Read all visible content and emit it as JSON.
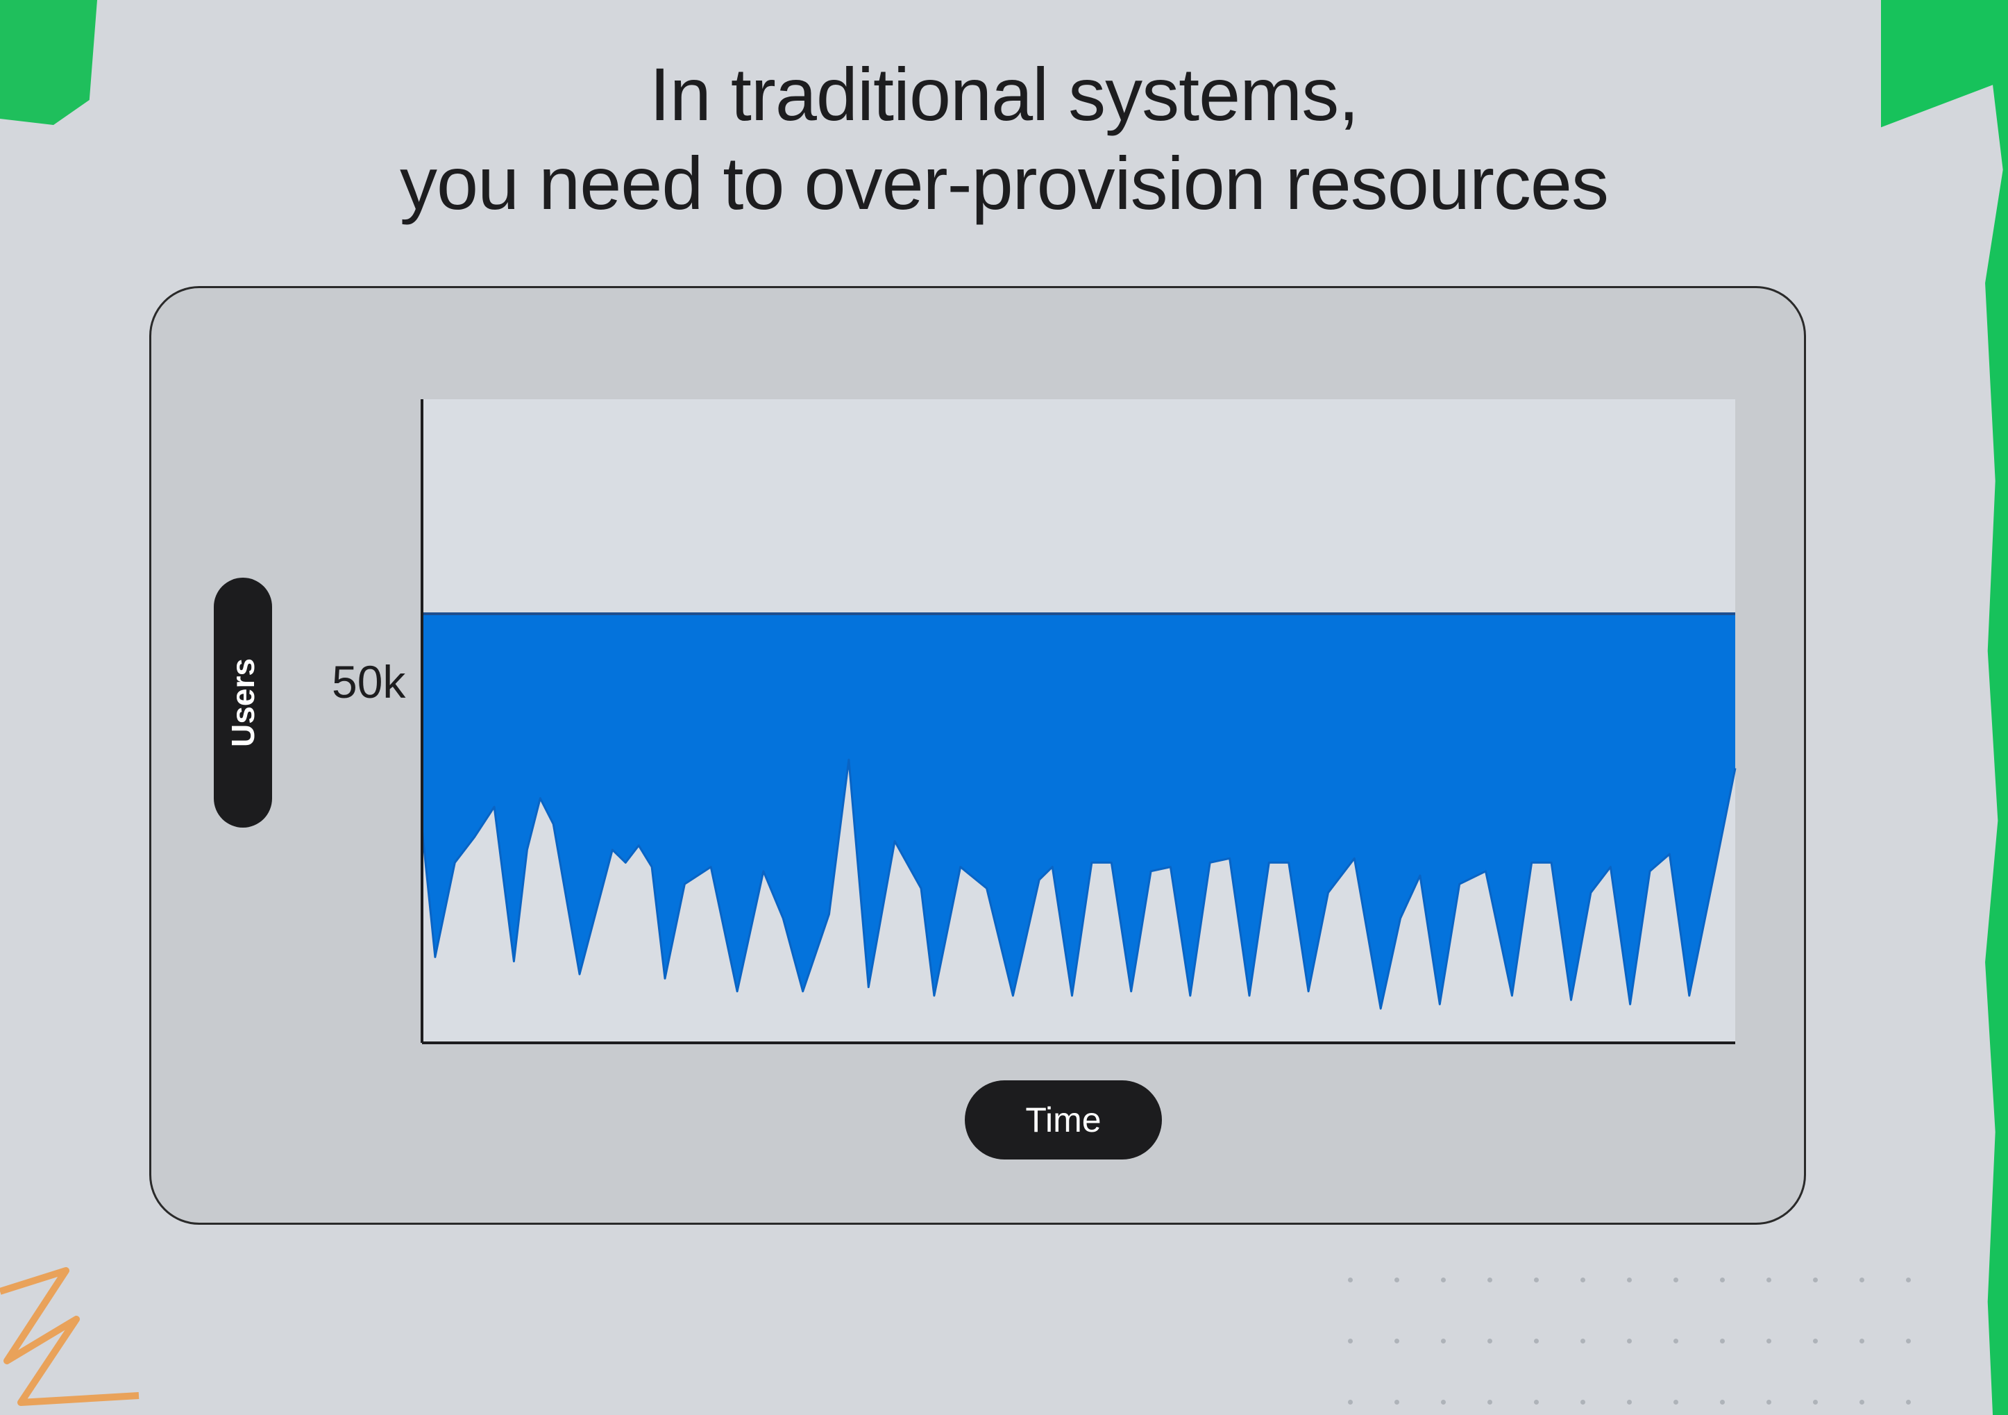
{
  "slide": {
    "title_line1": "In traditional systems,",
    "title_line2": "you need to over-provision resources"
  },
  "colors": {
    "background": "#d4d7dc",
    "accent_green": "#17c25b",
    "provisioned_fill": "#0473dc",
    "plot_background": "#d9dde3",
    "pill": "#1c1c1e"
  },
  "chart_data": {
    "type": "area",
    "title": "",
    "xlabel": "Time",
    "ylabel": "Users",
    "y_tick_labels": [
      {
        "value": 50000,
        "label": "50k"
      }
    ],
    "ylim": [
      0,
      75000
    ],
    "grid": false,
    "series": [
      {
        "name": "",
        "role": "provisioned capacity (flat)",
        "color": "#0473dc",
        "x": [
          0,
          100
        ],
        "values": [
          50000,
          50000
        ]
      },
      {
        "name": "",
        "role": "actual demand (curve under blue fill)",
        "x": [
          0,
          1,
          2.5,
          4,
          5.5,
          7,
          8,
          9,
          10,
          12,
          14.5,
          15.5,
          16.5,
          17.5,
          18.5,
          20,
          22,
          24,
          26,
          27.5,
          29,
          31,
          32.5,
          34,
          36,
          38,
          39,
          41,
          43,
          45,
          47,
          48,
          49.5,
          51,
          52.5,
          54,
          55.5,
          57,
          58.5,
          60,
          61.5,
          63,
          64.5,
          66,
          67.5,
          69,
          71,
          73,
          74.5,
          76,
          77.5,
          79,
          81,
          83,
          84.5,
          86,
          87.5,
          89,
          90.5,
          92,
          93.5,
          95,
          96.5,
          98.5,
          100
        ],
        "values": [
          25000,
          10000,
          21000,
          24000,
          27500,
          9500,
          22500,
          28500,
          25500,
          8000,
          22500,
          21000,
          23000,
          20500,
          7500,
          18500,
          20500,
          6000,
          20000,
          14500,
          6000,
          15000,
          33000,
          6500,
          23500,
          18000,
          5500,
          20500,
          18000,
          5500,
          19000,
          20500,
          5500,
          21000,
          21000,
          6000,
          20000,
          20500,
          5500,
          21000,
          21500,
          5500,
          21000,
          21000,
          6000,
          17500,
          21500,
          4000,
          14500,
          19500,
          4500,
          18500,
          20000,
          5500,
          21000,
          21000,
          5000,
          17500,
          20500,
          4500,
          20000,
          22000,
          5500,
          20500,
          32000
        ]
      }
    ]
  }
}
